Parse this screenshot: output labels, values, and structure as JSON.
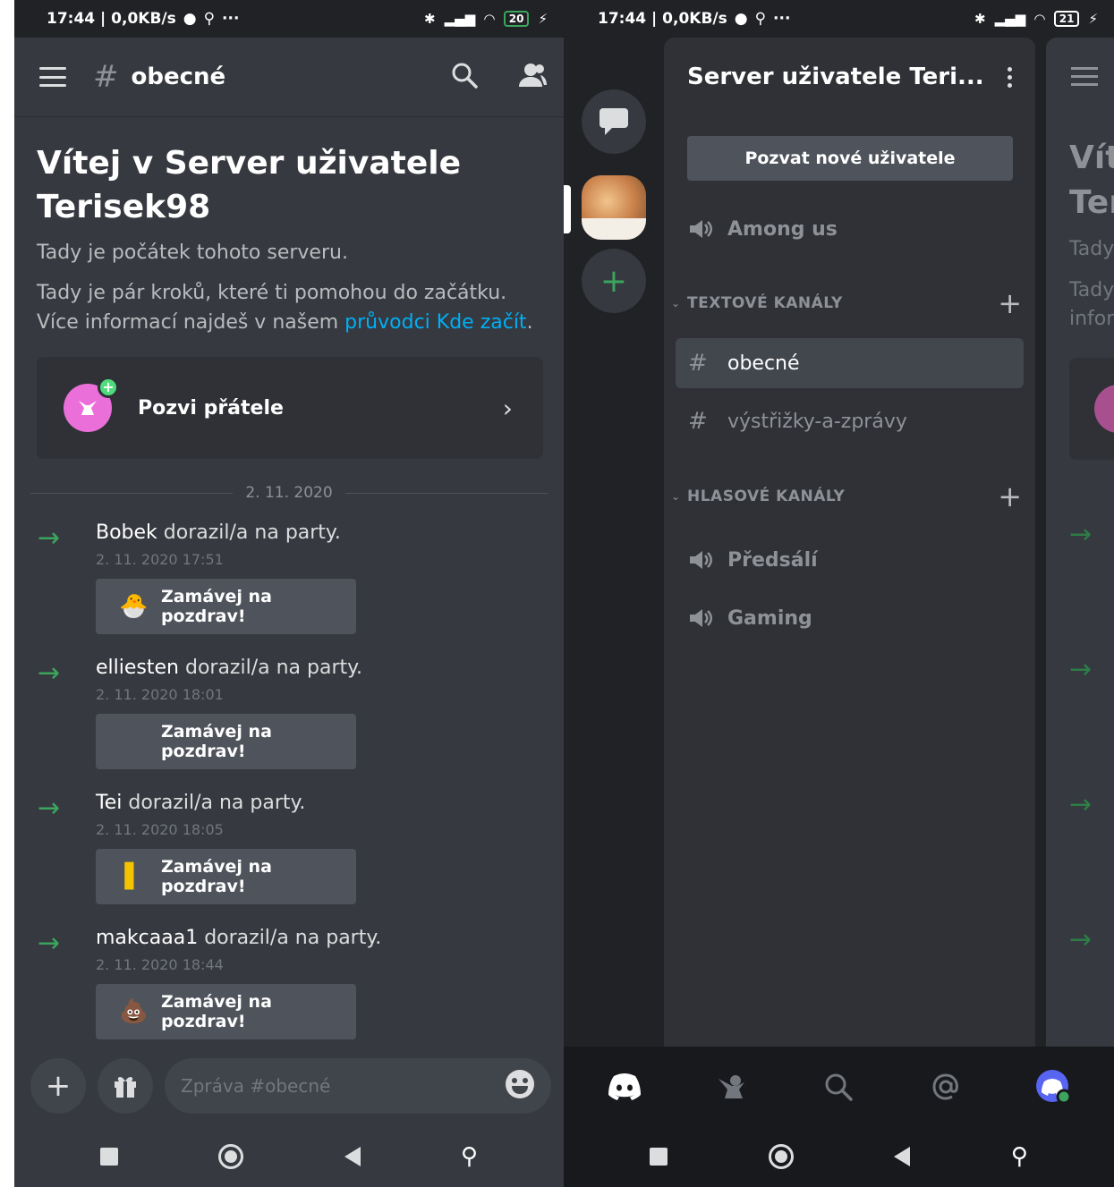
{
  "status_bar": {
    "time": "17:44",
    "speed": "0,0KB/s",
    "left_battery": "20",
    "right_battery": "21"
  },
  "chat": {
    "channel_name": "obecné",
    "welcome_title": "Vítej v Server uživatele Terisek98",
    "welcome_sub": "Tady je počátek tohoto serveru.",
    "welcome_desc_before": "Tady je pár kroků, které ti pomohou do začátku. Více informací najdeš v našem ",
    "welcome_link": "průvodci Kde začít",
    "welcome_desc_after": ".",
    "invite_friends_label": "Pozvi přátele",
    "date_divider": "2. 11. 2020",
    "messages": [
      {
        "name": "Bobek",
        "text": " dorazil/a na party.",
        "timestamp": "2. 11. 2020 17:51",
        "wave_label": "Zamávej na pozdrav!",
        "sticker": "🐣"
      },
      {
        "name": "elliesten",
        "text": " dorazil/a na party.",
        "timestamp": "2. 11. 2020 18:01",
        "wave_label": "Zamávej na pozdrav!",
        "sticker": ""
      },
      {
        "name": "Tei",
        "text": " dorazil/a na party.",
        "timestamp": "2. 11. 2020 18:05",
        "wave_label": "Zamávej na pozdrav!",
        "sticker": "▌"
      },
      {
        "name": "makcaaa1",
        "text": " dorazil/a na party.",
        "timestamp": "2. 11. 2020 18:44",
        "wave_label": "Zamávej na pozdrav!",
        "sticker": "💩"
      }
    ],
    "composer_placeholder": "Zpráva #obecné"
  },
  "server": {
    "name": "Server uživatele Teri...",
    "invite_button": "Pozvat nové uživatele",
    "top_voice": "Among us",
    "text_category": "TEXTOVÉ KANÁLY",
    "text_channels": [
      "obecné",
      "výstřižky-a-zprávy"
    ],
    "voice_category": "HLASOVÉ KANÁLY",
    "voice_channels": [
      "Předsálí",
      "Gaming"
    ]
  },
  "peek": {
    "title_1": "Vít",
    "title_2": "Ter",
    "line_1": "Tady",
    "line_2": "Tady",
    "line_3": "infor"
  },
  "colors": {
    "accent_green": "#3ba55d",
    "link_blue": "#00aff4",
    "invite_pink": "#eb6fd9",
    "discord_blurple": "#5865f2"
  }
}
